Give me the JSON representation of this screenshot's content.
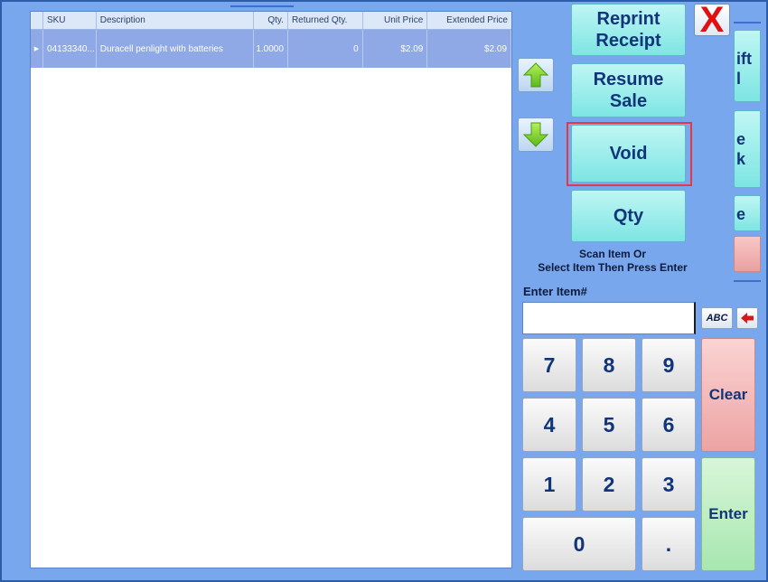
{
  "grid": {
    "columns": [
      "SKU",
      "Description",
      "Qty.",
      "Returned Qty.",
      "Unit Price",
      "Extended Price"
    ],
    "rows": [
      {
        "sku": "04133340...",
        "description": "Duracell penlight with batteries",
        "qty": "1.0000",
        "returned_qty": "0",
        "unit_price": "$2.09",
        "extended_price": "$2.09"
      }
    ]
  },
  "buttons": {
    "reprint_line1": "Reprint",
    "reprint_line2": "Receipt",
    "resume_line1": "Resume",
    "resume_line2": "Sale",
    "void": "Void",
    "qty": "Qty",
    "close": "X"
  },
  "side_strip": {
    "item1_line1": "ift",
    "item1_line2": "l",
    "item2_line1": "e",
    "item2_line2": "k",
    "item3": "e"
  },
  "instructions": {
    "line1": "Scan Item Or",
    "line2": "Select Item Then Press Enter"
  },
  "entry": {
    "label": "Enter Item#",
    "value": "",
    "abc": "ABC"
  },
  "keypad": {
    "k7": "7",
    "k8": "8",
    "k9": "9",
    "k4": "4",
    "k5": "5",
    "k6": "6",
    "k1": "1",
    "k2": "2",
    "k3": "3",
    "k0": "0",
    "dot": ".",
    "clear": "Clear",
    "enter": "Enter"
  },
  "colors": {
    "background": "#78a7ee",
    "selected_row": "#8fa8e6",
    "aqua_button": "#7de5e3",
    "void_highlight": "#e03a48",
    "clear_key": "#eda3a3",
    "enter_key": "#a8e6b0",
    "button_text": "#12357a"
  },
  "icons": {
    "up": "arrow-up-icon",
    "down": "arrow-down-icon",
    "close": "close-icon",
    "backspace": "arrow-left-icon"
  }
}
